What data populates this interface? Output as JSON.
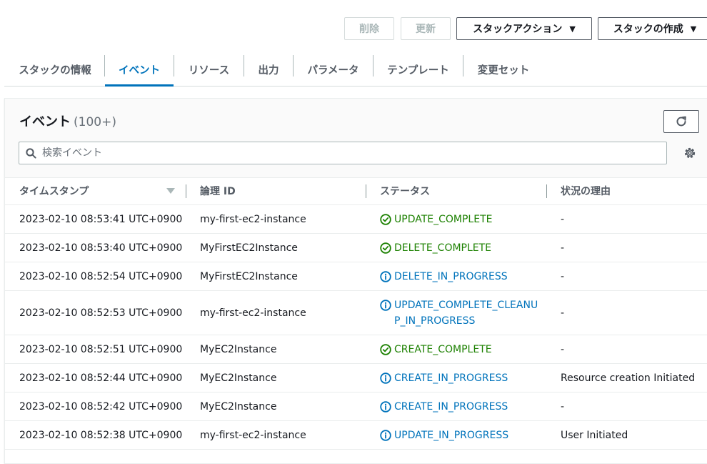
{
  "toolbar": {
    "delete_label": "削除",
    "update_label": "更新",
    "stack_actions_label": "スタックアクション",
    "create_stack_label": "スタックの作成"
  },
  "tabs": [
    {
      "label": "スタックの情報",
      "active": false
    },
    {
      "label": "イベント",
      "active": true
    },
    {
      "label": "リソース",
      "active": false
    },
    {
      "label": "出力",
      "active": false
    },
    {
      "label": "パラメータ",
      "active": false
    },
    {
      "label": "テンプレート",
      "active": false
    },
    {
      "label": "変更セット",
      "active": false
    }
  ],
  "events": {
    "title": "イベント",
    "count": "(100+)",
    "search_placeholder": "検索イベント",
    "columns": {
      "timestamp": "タイムスタンプ",
      "logical_id": "論理 ID",
      "status": "ステータス",
      "reason": "状況の理由"
    },
    "rows": [
      {
        "timestamp": "2023-02-10 08:53:41 UTC+0900",
        "logical_id": "my-first-ec2-instance",
        "status_line1": "UPDATE_COMPLETE",
        "status_line2": "",
        "status_kind": "success",
        "reason": "-"
      },
      {
        "timestamp": "2023-02-10 08:53:40 UTC+0900",
        "logical_id": "MyFirstEC2Instance",
        "status_line1": "DELETE_COMPLETE",
        "status_line2": "",
        "status_kind": "success",
        "reason": "-"
      },
      {
        "timestamp": "2023-02-10 08:52:54 UTC+0900",
        "logical_id": "MyFirstEC2Instance",
        "status_line1": "DELETE_IN_PROGRESS",
        "status_line2": "",
        "status_kind": "info",
        "reason": "-"
      },
      {
        "timestamp": "2023-02-10 08:52:53 UTC+0900",
        "logical_id": "my-first-ec2-instance",
        "status_line1": "UPDATE_COMPLETE_CLEANU",
        "status_line2": "P_IN_PROGRESS",
        "status_kind": "info",
        "reason": "-"
      },
      {
        "timestamp": "2023-02-10 08:52:51 UTC+0900",
        "logical_id": "MyEC2Instance",
        "status_line1": "CREATE_COMPLETE",
        "status_line2": "",
        "status_kind": "success",
        "reason": "-"
      },
      {
        "timestamp": "2023-02-10 08:52:44 UTC+0900",
        "logical_id": "MyEC2Instance",
        "status_line1": "CREATE_IN_PROGRESS",
        "status_line2": "",
        "status_kind": "info",
        "reason": "Resource creation Initiated"
      },
      {
        "timestamp": "2023-02-10 08:52:42 UTC+0900",
        "logical_id": "MyEC2Instance",
        "status_line1": "CREATE_IN_PROGRESS",
        "status_line2": "",
        "status_kind": "info",
        "reason": "-"
      },
      {
        "timestamp": "2023-02-10 08:52:38 UTC+0900",
        "logical_id": "my-first-ec2-instance",
        "status_line1": "UPDATE_IN_PROGRESS",
        "status_line2": "",
        "status_kind": "info",
        "reason": "User Initiated"
      }
    ]
  },
  "colors": {
    "accent": "#0073bb",
    "success": "#1d8102",
    "info": "#0073bb"
  },
  "icons": {
    "refresh": "refresh-icon",
    "search": "search-icon",
    "settings": "gear-icon",
    "sort": "sort-descending-icon",
    "success": "check-circle-icon",
    "info": "info-circle-icon",
    "caret": "caret-down-icon"
  }
}
